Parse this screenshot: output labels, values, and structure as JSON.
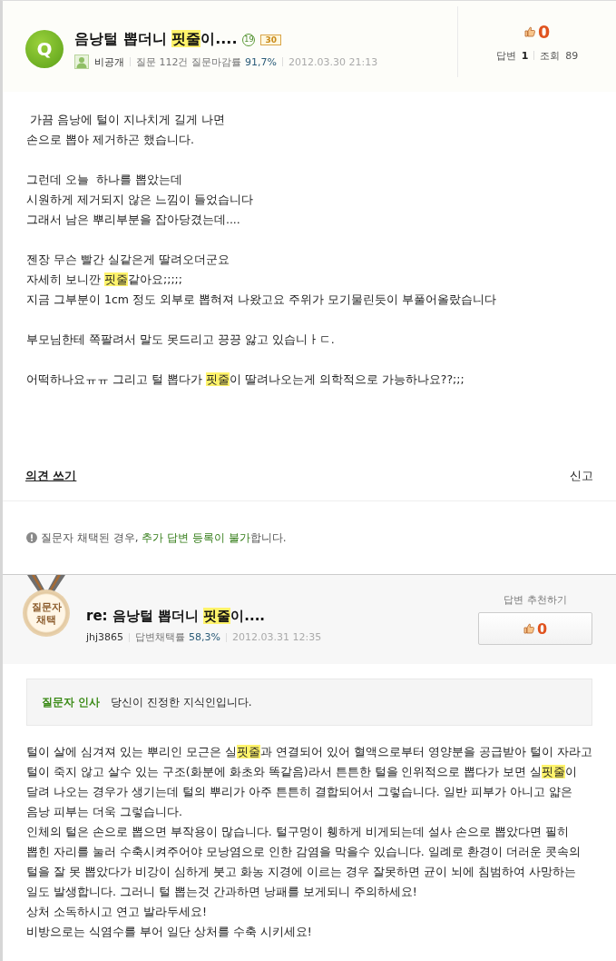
{
  "question": {
    "badge": "Q",
    "title": [
      {
        "text": "음낭털 뽑더니 ",
        "highlighted": false
      },
      {
        "text": "핏줄",
        "highlighted": true
      },
      {
        "text": "이....",
        "highlighted": false
      }
    ],
    "age_badge": "19",
    "points_badge": "30",
    "author": "비공개",
    "question_stats_label": "질문 112건 질문마감률",
    "question_close_rate": "91,7%",
    "date": "2012.03.30 21:13",
    "likes": "0",
    "answers_label": "답변",
    "answers": "1",
    "views_label": "조회",
    "views": "89",
    "body": [
      [
        [
          {
            "text": " 가끔 음낭에 털이 지나치게 길게 나면",
            "highlighted": false
          }
        ],
        [
          {
            "text": "손으로 뽑아 제거하곤 했습니다.",
            "highlighted": false
          }
        ]
      ],
      [
        [
          {
            "text": "그런데 오늘  하나를 뽑았는데",
            "highlighted": false
          }
        ],
        [
          {
            "text": "시원하게 제거되지 않은 느낌이 들었습니다",
            "highlighted": false
          }
        ],
        [
          {
            "text": "그래서 남은 뿌리부분을 잡아당겼는데....",
            "highlighted": false
          }
        ]
      ],
      [
        [
          {
            "text": "젠장 무슨 빨간 실같은게 딸려오더군요",
            "highlighted": false
          }
        ],
        [
          {
            "text": "자세히 보니깐 ",
            "highlighted": false
          },
          {
            "text": "핏줄",
            "highlighted": true
          },
          {
            "text": "같아요;;;;;",
            "highlighted": false
          }
        ],
        [
          {
            "text": "지금 그부분이 1cm 정도 외부로 뽑혀져 나왔고요 주위가 모기물린듯이 부풀어올랐습니다",
            "highlighted": false
          }
        ]
      ],
      [
        [
          {
            "text": "부모님한테 쪽팔려서 말도 못드리고 끙끙 앓고 있습니ㅏㄷ.",
            "highlighted": false
          }
        ]
      ],
      [
        [
          {
            "text": "어떡하나요ㅠㅠ 그리고 털 뽑다가 ",
            "highlighted": false
          },
          {
            "text": "핏줄",
            "highlighted": true
          },
          {
            "text": "이 딸려나오는게 의학적으로 가능하나요??;;;",
            "highlighted": false
          }
        ]
      ]
    ],
    "comment_link": "의견 쓰기",
    "report_link": "신고"
  },
  "notice": {
    "text_before": "질문자 채택된 경우, ",
    "emphasis": "추가 답변 등록이 불가",
    "text_after": "합니다."
  },
  "answer": {
    "medal": [
      "질문자",
      "채택"
    ],
    "title": [
      {
        "text": "re: 음낭털 뽑더니 ",
        "highlighted": false
      },
      {
        "text": "핏줄",
        "highlighted": true
      },
      {
        "text": "이....",
        "highlighted": false
      }
    ],
    "author": "jhj3865",
    "rate_label": "답변채택률",
    "rate": "58,3%",
    "date": "2012.03.31 12:35",
    "recommend_label": "답변 추천하기",
    "likes": "0",
    "greeting_label": "질문자 인사",
    "greeting": "당신이 진정한 지식인입니다.",
    "body": [
      [
        {
          "text": "털이 살에 심겨져 있는 뿌리인 모근은 실",
          "highlighted": false
        },
        {
          "text": "핏줄",
          "highlighted": true
        },
        {
          "text": "과 연결되어 있어 혈액으로부터 영양분을 공급받아 털이 자라고 털이 죽지 않고 살수 있는 구조(화분에 화초와 똑같음)라서 튼튼한 털을 인위적으로 뽑다가 보면 실",
          "highlighted": false
        },
        {
          "text": "핏줄",
          "highlighted": true
        },
        {
          "text": "이 달려 나오는 경우가 생기는데 털의 뿌리가 아주 튼튼히 결합되어서 그렇습니다. 일반 피부가 아니고 얇은 음낭 피부는 더욱 그렇습니다.",
          "highlighted": false
        }
      ],
      [
        {
          "text": "인체의 털은 손으로 뽑으면 부작용이 많습니다. 털구멍이 휑하게 비게되는데 설사 손으로 뽑았다면 필히 뽑힌 자리를 눌러 수축시켜주어야 모낭염으로 인한 감염을 막을수 있습니다. 일례로 환경이 더러운 콧속의 털을 잘 못 뽑았다가 비강이 심하게 붓고 화농 지경에 이르는 경우 잘못하면 균이 뇌에 침범하여 사망하는 일도 발생합니다. 그러니 털 뽑는것 간과하면 낭패를 보게되니 주의하세요!",
          "highlighted": false
        }
      ],
      [
        {
          "text": "상처 소독하시고 연고 발라두세요!",
          "highlighted": false
        }
      ],
      [
        {
          "text": "비방으로는 식염수를 부어 일단 상처를 수축 시키세요!",
          "highlighted": false
        }
      ]
    ]
  }
}
